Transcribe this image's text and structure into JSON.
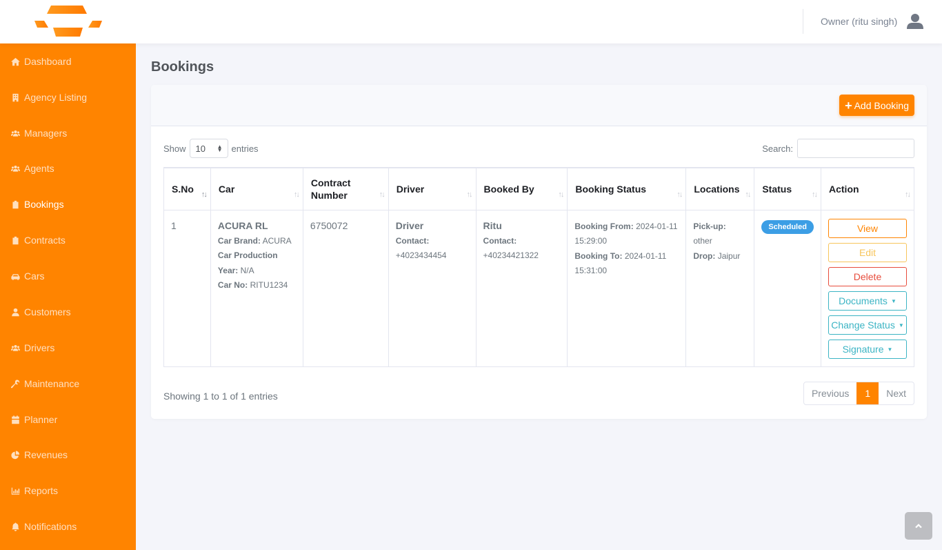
{
  "header": {
    "user_label": "Owner (ritu singh)",
    "brand_color": "#ff8400"
  },
  "sidebar": {
    "items": [
      {
        "label": "Dashboard",
        "icon": "home-icon"
      },
      {
        "label": "Agency Listing",
        "icon": "building-icon"
      },
      {
        "label": "Managers",
        "icon": "users-icon"
      },
      {
        "label": "Agents",
        "icon": "users-icon"
      },
      {
        "label": "Bookings",
        "icon": "clipboard-icon",
        "active": true
      },
      {
        "label": "Contracts",
        "icon": "clipboard-icon"
      },
      {
        "label": "Cars",
        "icon": "car-icon"
      },
      {
        "label": "Customers",
        "icon": "user-icon"
      },
      {
        "label": "Drivers",
        "icon": "users-icon"
      },
      {
        "label": "Maintenance",
        "icon": "wrench-icon"
      },
      {
        "label": "Planner",
        "icon": "calendar-icon"
      },
      {
        "label": "Revenues",
        "icon": "pie-chart-icon"
      },
      {
        "label": "Reports",
        "icon": "bar-chart-icon"
      },
      {
        "label": "Notifications",
        "icon": "bell-icon"
      }
    ]
  },
  "page": {
    "title": "Bookings",
    "add_button": "Add Booking",
    "show_label": "Show",
    "entries_label": "entries",
    "page_length": "10",
    "search_label": "Search:",
    "search_value": "",
    "info": "Showing 1 to 1 of 1 entries",
    "pagination": {
      "previous": "Previous",
      "current": "1",
      "next": "Next"
    }
  },
  "table": {
    "columns": [
      "S.No",
      "Car",
      "Contract Number",
      "Driver",
      "Booked By",
      "Booking Status",
      "Locations",
      "Status",
      "Action"
    ],
    "rows": [
      {
        "sno": "1",
        "car": {
          "name": "ACURA RL",
          "brand_label": "Car Brand:",
          "brand": "ACURA",
          "year_label": "Car Production Year:",
          "year": "N/A",
          "no_label": "Car No:",
          "no": "RITU1234"
        },
        "contract_number": "6750072",
        "driver": {
          "name": "Driver",
          "contact_label": "Contact:",
          "contact": "+4023434454"
        },
        "booked_by": {
          "name": "Ritu",
          "contact_label": "Contact:",
          "contact": "+40234421322"
        },
        "booking_status": {
          "from_label": "Booking From:",
          "from": "2024-01-11 15:29:00",
          "to_label": "Booking To:",
          "to": "2024-01-11 15:31:00"
        },
        "locations": {
          "pickup_label": "Pick-up:",
          "pickup": "other",
          "drop_label": "Drop:",
          "drop": "Jaipur"
        },
        "status": "Scheduled",
        "actions": {
          "view": "View",
          "edit": "Edit",
          "delete": "Delete",
          "documents": "Documents",
          "change_status": "Change Status",
          "signature": "Signature"
        }
      }
    ]
  }
}
